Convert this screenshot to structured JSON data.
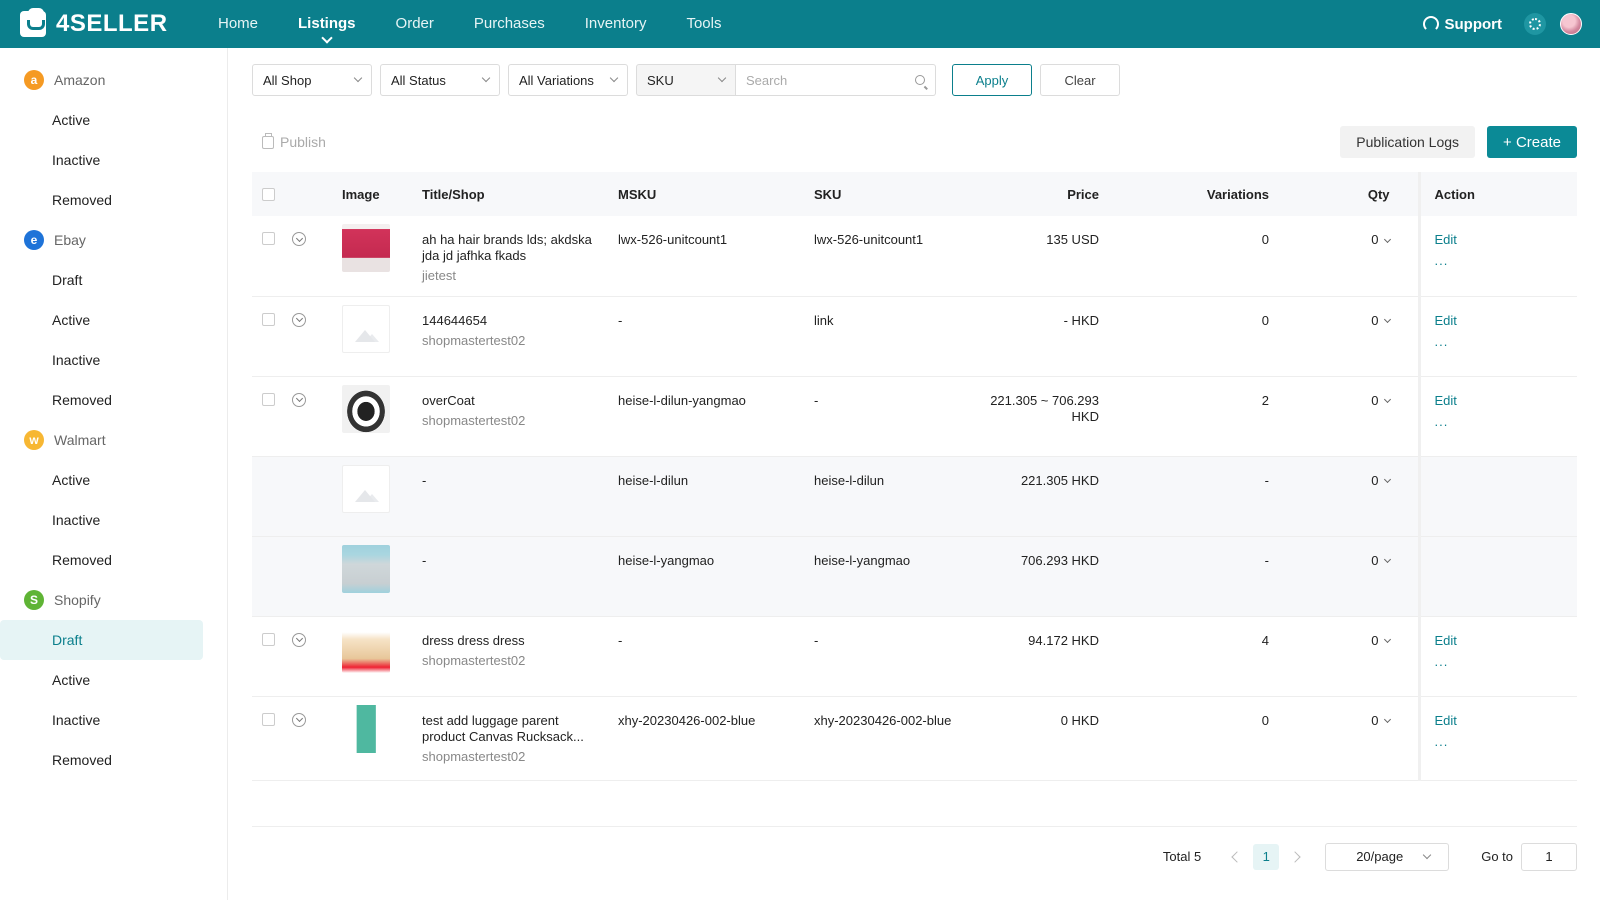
{
  "brand": {
    "name": "4SELLER"
  },
  "nav": {
    "items": [
      {
        "label": "Home",
        "active": false
      },
      {
        "label": "Listings",
        "active": true
      },
      {
        "label": "Order",
        "active": false
      },
      {
        "label": "Purchases",
        "active": false
      },
      {
        "label": "Inventory",
        "active": false
      },
      {
        "label": "Tools",
        "active": false
      }
    ],
    "support_label": "Support"
  },
  "sidebar": {
    "amazon": {
      "label": "Amazon",
      "badge": "a",
      "color": "#f59a23",
      "items": [
        "Active",
        "Inactive",
        "Removed"
      ]
    },
    "ebay": {
      "label": "Ebay",
      "badge": "e",
      "color": "#1e73d8",
      "items": [
        "Draft",
        "Active",
        "Inactive",
        "Removed"
      ]
    },
    "walmart": {
      "label": "Walmart",
      "badge": "w",
      "color": "#f7b733",
      "items": [
        "Active",
        "Inactive",
        "Removed"
      ]
    },
    "shopify": {
      "label": "Shopify",
      "badge": "S",
      "color": "#5fb435",
      "items": [
        "Draft",
        "Active",
        "Inactive",
        "Removed"
      ],
      "selected": "Draft"
    }
  },
  "filters": {
    "shop": "All Shop",
    "status": "All Status",
    "variations": "All Variations",
    "search_field": "SKU",
    "search_placeholder": "Search",
    "apply_label": "Apply",
    "clear_label": "Clear"
  },
  "toolbar": {
    "publish_label": "Publish",
    "logs_label": "Publication Logs",
    "create_label": "+ Create"
  },
  "table": {
    "headers": {
      "image": "Image",
      "title": "Title/Shop",
      "msku": "MSKU",
      "sku": "SKU",
      "price": "Price",
      "variations": "Variations",
      "qty": "Qty",
      "action": "Action"
    },
    "edit_label": "Edit",
    "more_label": "...",
    "rows": [
      {
        "title": "ah ha hair brands lds; akdska jda jd jafhka fkads",
        "shop": "jietest",
        "msku": "lwx-526-unitcount1",
        "sku": "lwx-526-unitcount1",
        "price": "135 USD",
        "variations": "0",
        "qty": "0"
      },
      {
        "title": "144644654",
        "shop": "shopmastertest02",
        "msku": "-",
        "sku": "link",
        "price": "- HKD",
        "variations": "0",
        "qty": "0"
      },
      {
        "title": "overCoat",
        "shop": "shopmastertest02",
        "msku": "heise-l-dilun-yangmao",
        "sku": "-",
        "price": "221.305 ~ 706.293 HKD",
        "variations": "2",
        "qty": "0"
      },
      {
        "title": "-",
        "msku": "heise-l-dilun",
        "sku": "heise-l-dilun",
        "price": "221.305 HKD",
        "variations": "-",
        "qty": "0"
      },
      {
        "title": "-",
        "msku": "heise-l-yangmao",
        "sku": "heise-l-yangmao",
        "price": "706.293 HKD",
        "variations": "-",
        "qty": "0"
      },
      {
        "title": "dress dress dress",
        "shop": "shopmastertest02",
        "msku": "-",
        "sku": "-",
        "price": "94.172 HKD",
        "variations": "4",
        "qty": "0"
      },
      {
        "title": "test add luggage parent product Canvas Rucksack...",
        "shop": "shopmastertest02",
        "msku": "xhy-20230426-002-blue",
        "sku": "xhy-20230426-002-blue",
        "price": "0 HKD",
        "variations": "0",
        "qty": "0"
      }
    ]
  },
  "pagination": {
    "total_label": "Total 5",
    "current_page": "1",
    "page_size": "20/page",
    "goto_label": "Go to",
    "goto_value": "1"
  }
}
